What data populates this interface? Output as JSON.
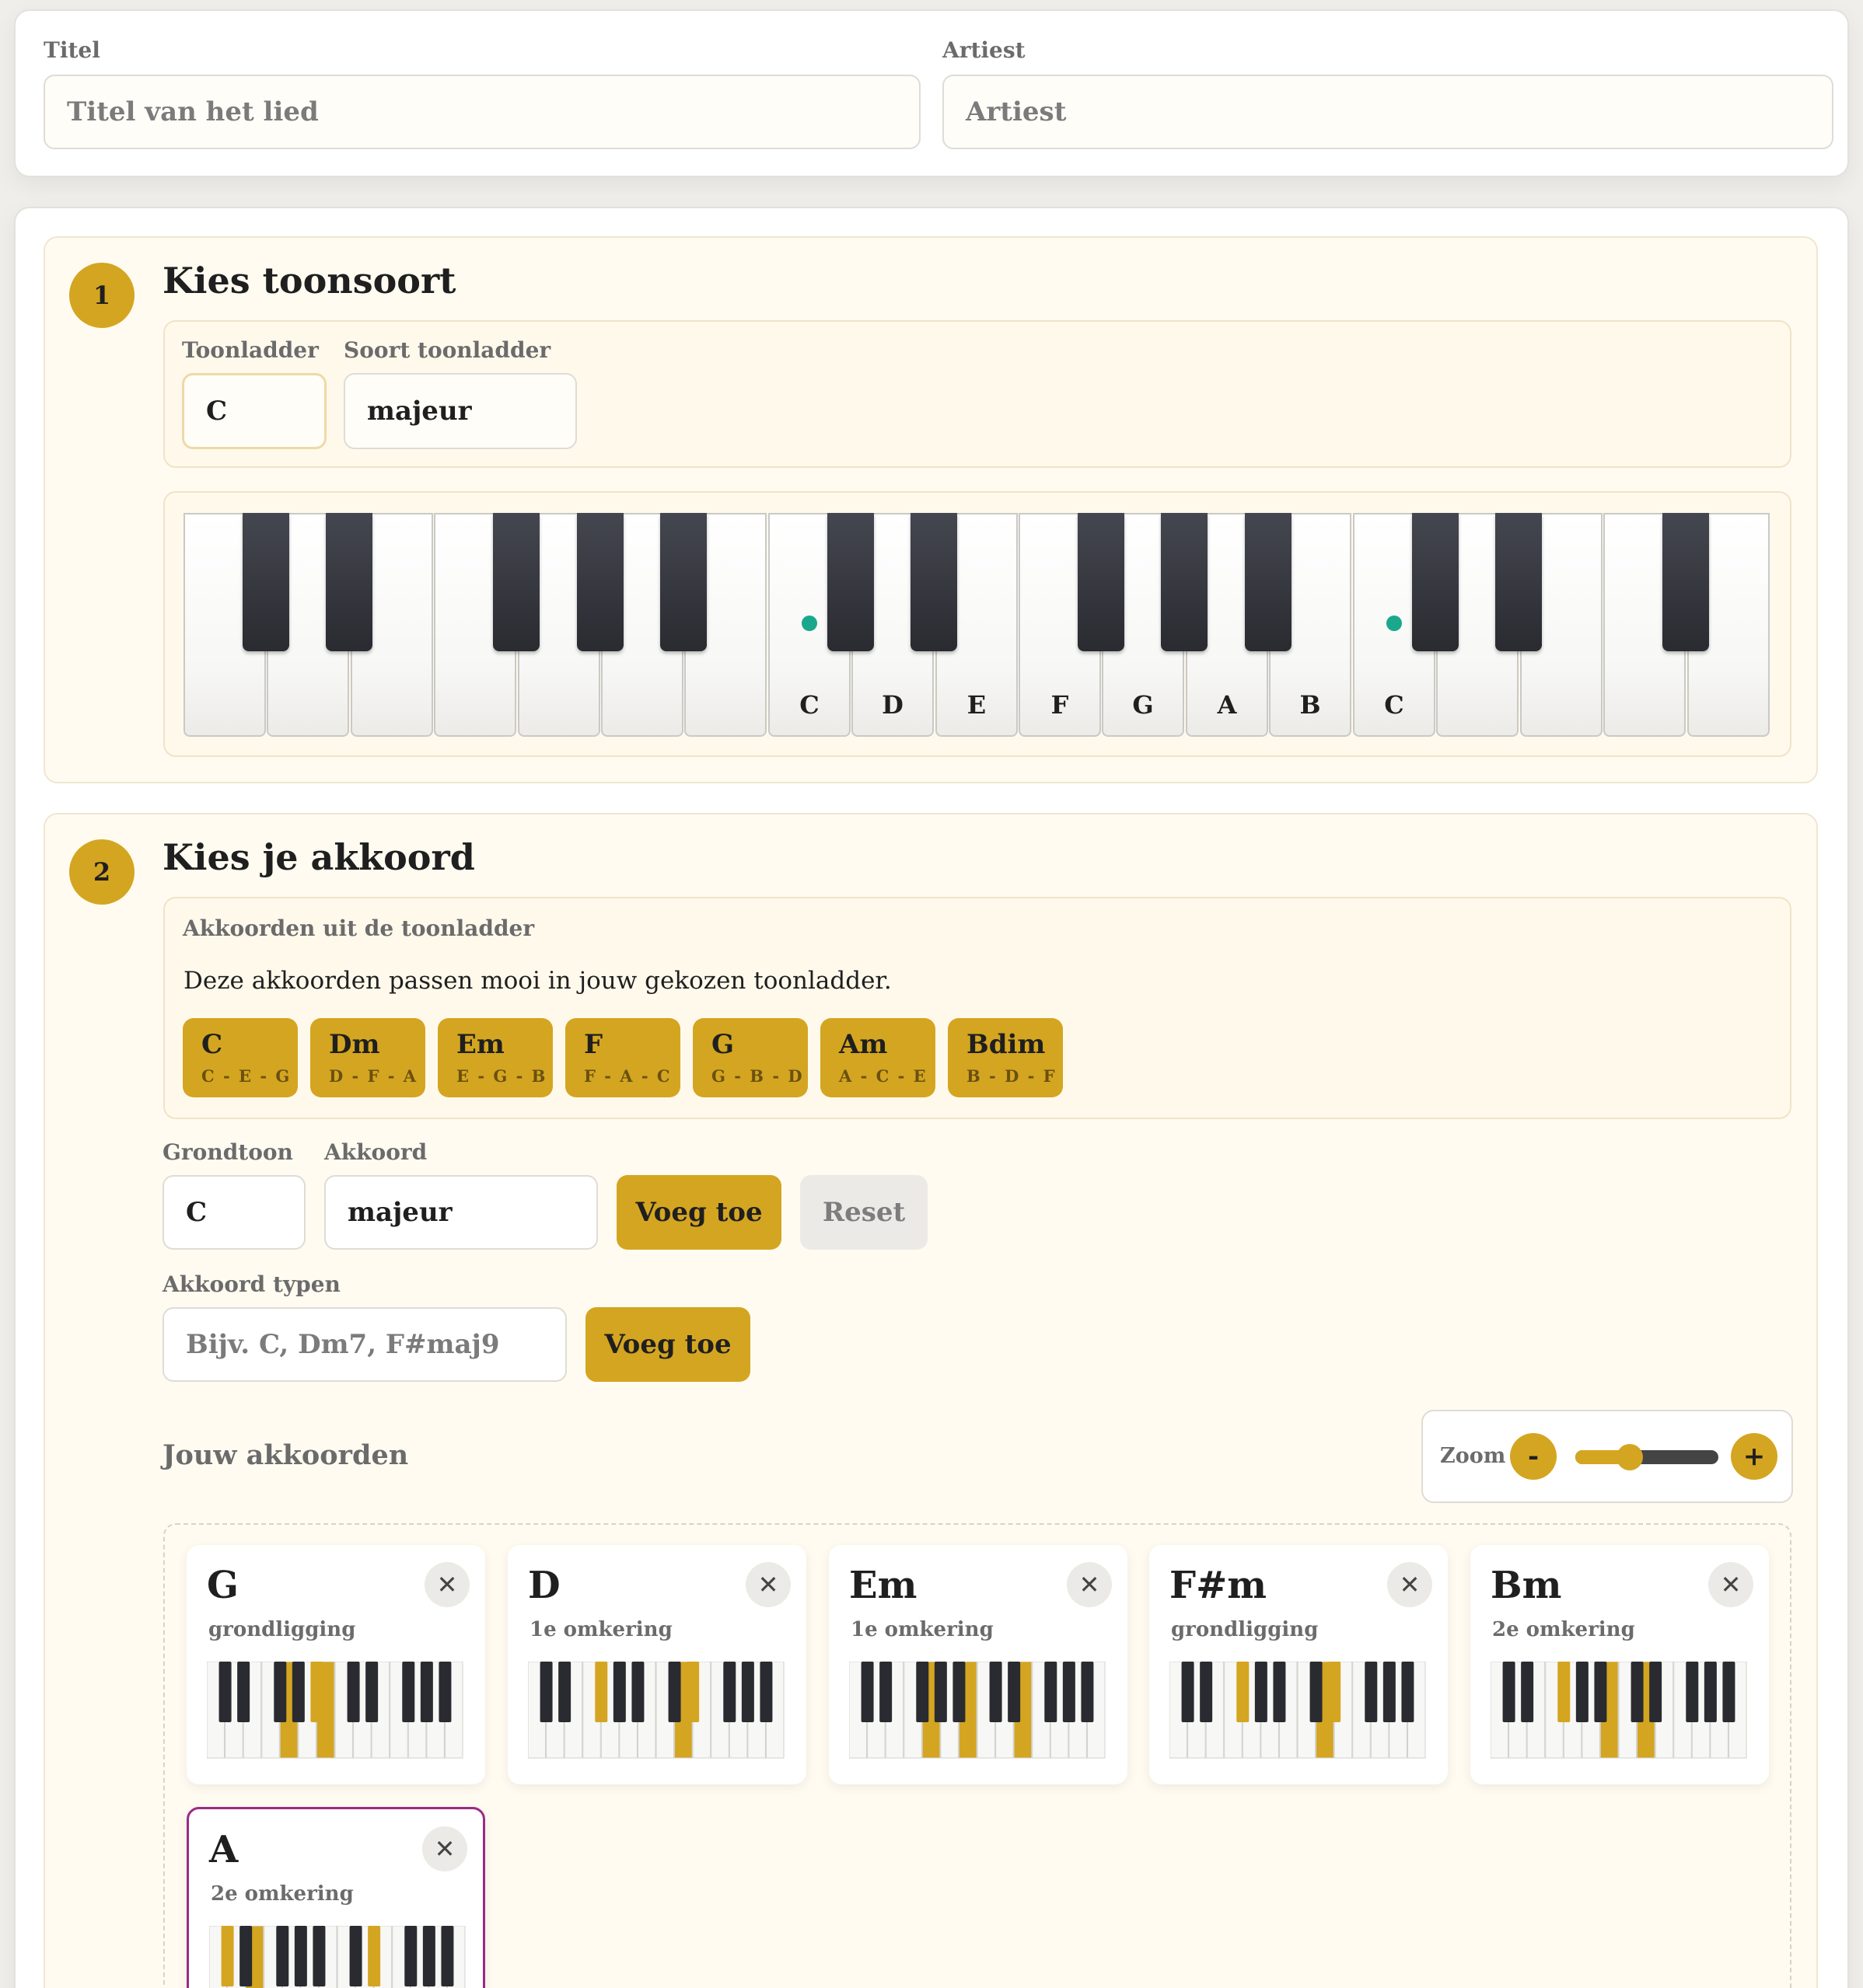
{
  "song": {
    "title_label": "Titel",
    "title_placeholder": "Titel van het lied",
    "artist_label": "Artiest",
    "artist_placeholder": "Artiest"
  },
  "step1": {
    "number": "1",
    "heading": "Kies toonsoort",
    "scale_label": "Toonladder",
    "scale_value": "C",
    "type_label": "Soort toonladder",
    "type_value": "majeur",
    "keyboard_labels": [
      "C",
      "D",
      "E",
      "F",
      "G",
      "A",
      "B",
      "C"
    ]
  },
  "step2": {
    "number": "2",
    "heading": "Kies je akkoord",
    "suggest_title": "Akkoorden uit de toonladder",
    "suggest_desc": "Deze akkoorden passen mooi in jouw gekozen toonladder.",
    "chips": [
      {
        "name": "C",
        "notes": "C - E - G"
      },
      {
        "name": "Dm",
        "notes": "D - F - A"
      },
      {
        "name": "Em",
        "notes": "E - G - B"
      },
      {
        "name": "F",
        "notes": "F - A - C"
      },
      {
        "name": "G",
        "notes": "G - B - D"
      },
      {
        "name": "Am",
        "notes": "A - C - E"
      },
      {
        "name": "Bdim",
        "notes": "B - D - F"
      }
    ],
    "root_label": "Grondtoon",
    "root_value": "C",
    "chord_label": "Akkoord",
    "chord_value": "majeur",
    "add_label": "Voeg toe",
    "reset_label": "Reset",
    "type_label": "Akkoord typen",
    "type_placeholder": "Bijv. C, Dm7, F#maj9",
    "add2_label": "Voeg toe",
    "your_chords_label": "Jouw akkoorden",
    "zoom_label": "Zoom",
    "zoom_minus": "-",
    "zoom_plus": "+",
    "zoom_level": 0.38,
    "close_symbol": "✕",
    "chords": [
      {
        "name": "G",
        "inversion": "grondligging"
      },
      {
        "name": "D",
        "inversion": "1e omkering"
      },
      {
        "name": "Em",
        "inversion": "1e omkering"
      },
      {
        "name": "F#m",
        "inversion": "grondligging"
      },
      {
        "name": "Bm",
        "inversion": "2e omkering"
      },
      {
        "name": "A",
        "inversion": "2e omkering"
      }
    ]
  },
  "colors": {
    "accent": "#d4a520",
    "selected_border": "#9b2a86",
    "marker": "#1aa88c"
  }
}
